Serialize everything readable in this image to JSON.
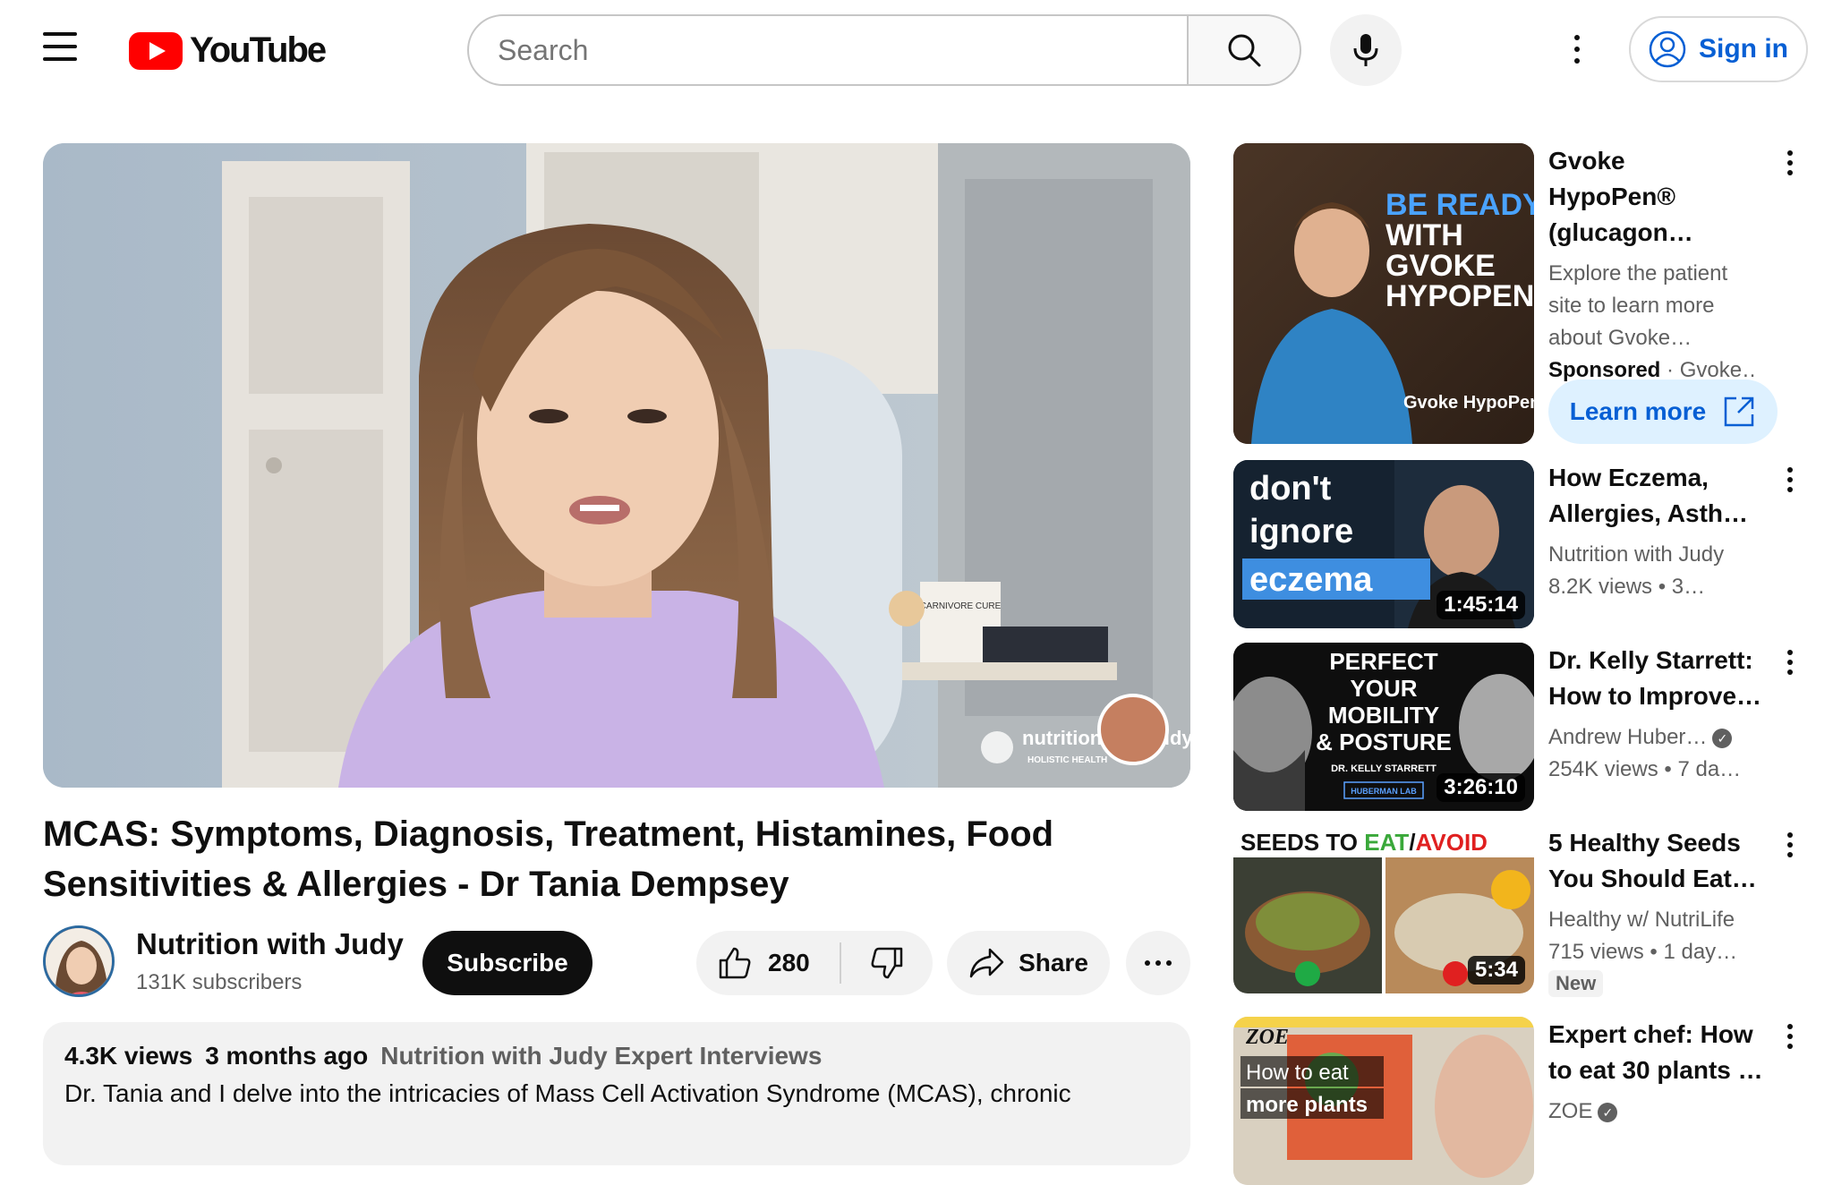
{
  "header": {
    "logo_text": "YouTube",
    "search_placeholder": "Search",
    "sign_in": "Sign in"
  },
  "video": {
    "title": "MCAS: Symptoms, Diagnosis, Treatment, Histamines, Food Sensitivities & Allergies - Dr Tania Dempsey",
    "overlay_brand": "nutrition with judy",
    "overlay_sub": "HOLISTIC HEALTH",
    "book_label": "CARNIVORE CURE"
  },
  "channel": {
    "name": "Nutrition with Judy",
    "subscribers": "131K subscribers",
    "subscribe_label": "Subscribe"
  },
  "actions": {
    "likes": "280",
    "share": "Share"
  },
  "description": {
    "views": "4.3K views",
    "date": "3 months ago",
    "playlist": "Nutrition with Judy Expert Interviews",
    "text": "Dr. Tania and I delve into the intricacies of Mass Cell Activation Syndrome (MCAS), chronic"
  },
  "sidebar": {
    "ad": {
      "title": "Gvoke HypoPen® (glucagon…",
      "desc": "Explore the patient site to learn more about Gvoke…",
      "sponsored": "Sponsored",
      "advertiser": "Gvoke…",
      "cta": "Learn more",
      "thumb_text_1": "BE READY",
      "thumb_text_2": "WITH",
      "thumb_text_3": "GVOKE",
      "thumb_text_4": "HYPOPEN",
      "thumb_brand": "Gvoke HypoPen"
    },
    "items": [
      {
        "title": "How Eczema, Allergies, Asth…",
        "channel": "Nutrition with Judy",
        "meta": "8.2K views  • 3…",
        "duration": "1:45:14",
        "thumb_text_1": "don't",
        "thumb_text_2": "ignore",
        "thumb_text_3": "eczema"
      },
      {
        "title": "Dr. Kelly Starrett: How to Improve…",
        "channel": "Andrew Huber…",
        "meta": "254K views  • 7 da…",
        "duration": "3:26:10",
        "thumb_text_1": "PERFECT",
        "thumb_text_2": "YOUR",
        "thumb_text_3": "MOBILITY",
        "thumb_text_4": "& POSTURE",
        "thumb_text_5": "DR. KELLY STARRETT",
        "thumb_text_6": "HUBERMAN LAB"
      },
      {
        "title": "5 Healthy Seeds You Should Eat…",
        "channel": "Healthy w/ NutriLife",
        "meta": "715 views  • 1 day…",
        "badge": "New",
        "duration": "5:34",
        "thumb_text_1": "SEEDS TO ",
        "thumb_text_2": "EAT",
        "thumb_text_3": "/",
        "thumb_text_4": "AVOID"
      },
      {
        "title": "Expert chef: How to eat 30 plants …",
        "channel": "ZOE",
        "thumb_text_1": "ZOE",
        "thumb_text_2": "How to eat",
        "thumb_text_3": "more plants"
      }
    ]
  },
  "colors": {
    "brand_red": "#ff0000",
    "link_blue": "#065fd4",
    "pill_bg": "#f2f2f2",
    "secondary_text": "#606060"
  }
}
